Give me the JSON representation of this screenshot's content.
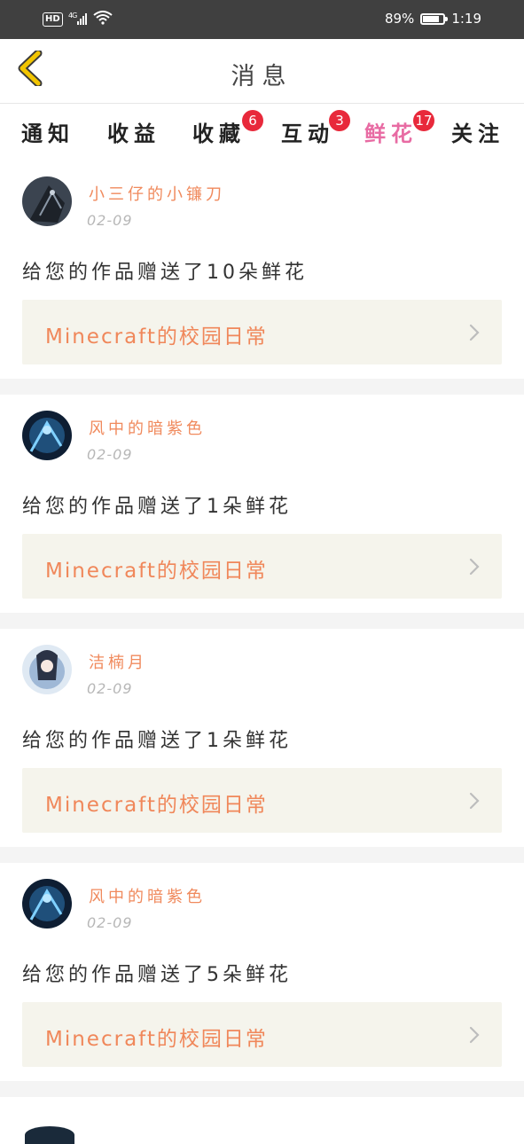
{
  "status_bar": {
    "network_hd": "HD",
    "network_type": "4G",
    "battery_percent": "89%",
    "battery_level": 0.89,
    "time": "1:19"
  },
  "header": {
    "title": "消息"
  },
  "tabs": [
    {
      "label": "通知",
      "badge": ""
    },
    {
      "label": "收益",
      "badge": ""
    },
    {
      "label": "收藏",
      "badge": "6"
    },
    {
      "label": "互动",
      "badge": "3"
    },
    {
      "label": "鲜花",
      "badge": "17",
      "active": true
    },
    {
      "label": "关注",
      "badge": ""
    }
  ],
  "items": [
    {
      "username": "小三仔的小镰刀",
      "date": "02-09",
      "message": "给您的作品赠送了10朵鲜花",
      "work_title": "Minecraft的校园日常"
    },
    {
      "username": "风中的暗紫色",
      "date": "02-09",
      "message": "给您的作品赠送了1朵鲜花",
      "work_title": "Minecraft的校园日常"
    },
    {
      "username": "洁楠月",
      "date": "02-09",
      "message": "给您的作品赠送了1朵鲜花",
      "work_title": "Minecraft的校园日常"
    },
    {
      "username": "风中的暗紫色",
      "date": "02-09",
      "message": "给您的作品赠送了5朵鲜花",
      "work_title": "Minecraft的校园日常"
    }
  ],
  "colors": {
    "accent": "#e86ba3",
    "username": "#f08a5d",
    "badge": "#e8293b",
    "back_icon": "#f2c500"
  }
}
